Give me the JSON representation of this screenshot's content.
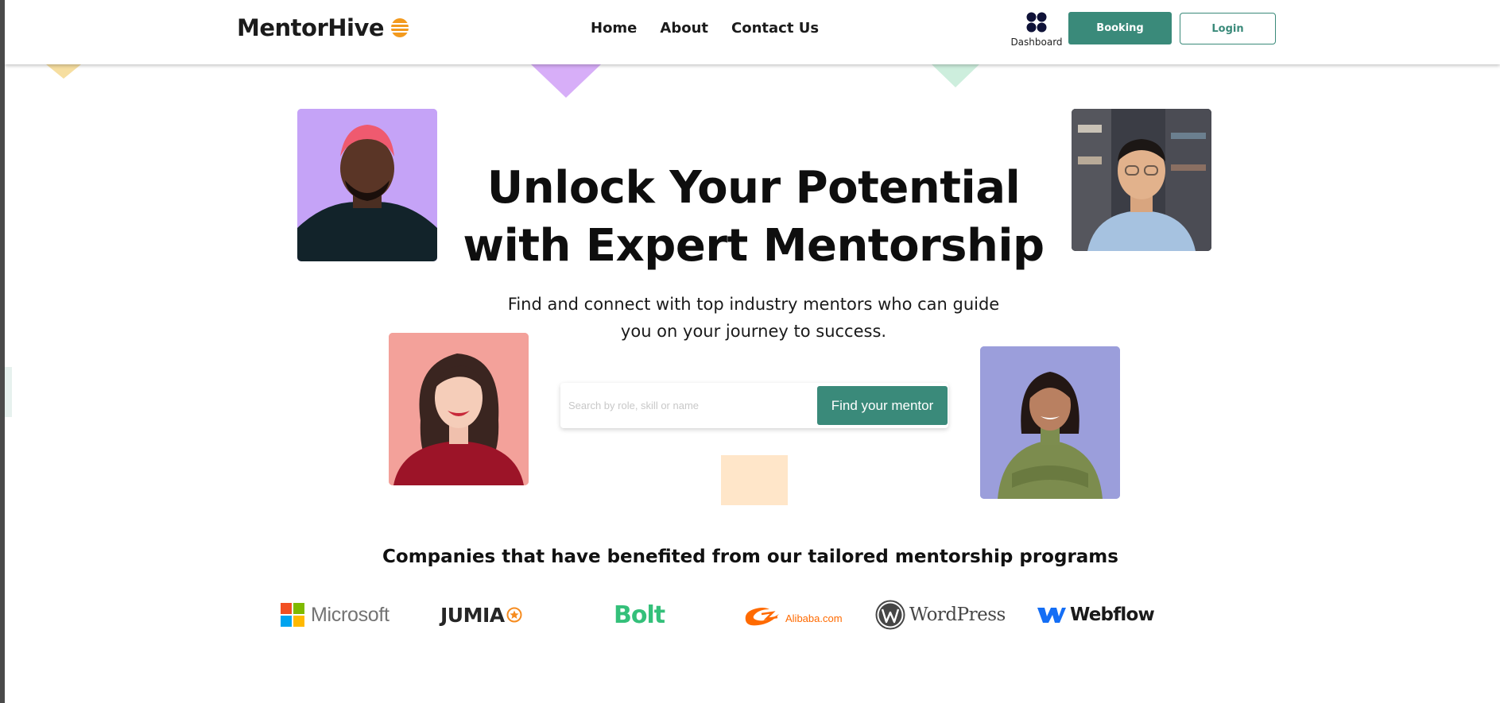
{
  "header": {
    "logo_text": "MentorHive",
    "nav": [
      {
        "label": "Home"
      },
      {
        "label": "About"
      },
      {
        "label": "Contact Us"
      }
    ],
    "dashboard_label": "Dashboard",
    "booking_label": "Booking",
    "login_label": "Login"
  },
  "hero": {
    "title_line1": "Unlock Your Potential",
    "title_line2": "with Expert Mentorship",
    "subtitle_line1": "Find and connect with top industry mentors who can guide",
    "subtitle_line2": "you on your journey to success."
  },
  "search": {
    "placeholder": "Search by role, skill or name",
    "value": "",
    "button_label": "Find your mentor"
  },
  "companies": {
    "title": "Companies that have benefited from our tailored mentorship programs",
    "logos": [
      {
        "name": "Microsoft",
        "icon": "microsoft-logo"
      },
      {
        "name": "JUMIA",
        "icon": "jumia-logo"
      },
      {
        "name": "Bolt",
        "icon": "bolt-logo"
      },
      {
        "name": "Alibaba.com",
        "icon": "alibaba-logo"
      },
      {
        "name": "WordPress",
        "icon": "wordpress-logo"
      },
      {
        "name": "Webflow",
        "icon": "webflow-logo"
      }
    ]
  },
  "colors": {
    "accent": "#3a8a7a",
    "logo_icon": "#f39a1e",
    "photo_bg_1": "#c5a3f7",
    "photo_bg_3": "#f3a19a",
    "photo_bg_4": "#9b9edb"
  }
}
